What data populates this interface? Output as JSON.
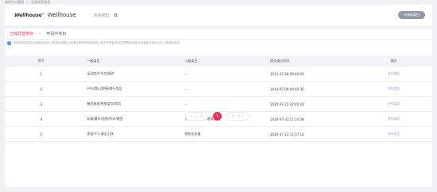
{
  "breadcrumb": {
    "parent": "商家中心管理",
    "current": "已有经营类目"
  },
  "shop": {
    "brand": "Wellhouse",
    "brand_mark": "®",
    "name": "Wellhouse",
    "type_label": "商家类型:",
    "type_value": "B",
    "apply_label": "申请新类目"
  },
  "tabs": [
    {
      "label": "已有经营类目",
      "active": true
    },
    {
      "label": "申请中类目",
      "active": false
    }
  ],
  "tab_separator": ">",
  "notice": "您的类目权限对应销售的商品上架类目范围,已经通过审核的类目商品上架将不受影响,若您需要申请新的经营类目请点击右上角按钮申请。",
  "table": {
    "headers": [
      "序号",
      "一级类目",
      "二级类目",
      "提交通过时间",
      "操作"
    ],
    "rows": [
      {
        "seq": "1",
        "cat1": "运动包/户外包/配件",
        "cat2": "--",
        "time": "2014-07-09 09:40:29",
        "action": "发布商品"
      },
      {
        "seq": "2",
        "cat1": "户外/登山/野营/旅行用品",
        "cat2": "--",
        "time": "2014-07-09 09:40:30",
        "action": "发布商品"
      },
      {
        "seq": "3",
        "cat1": "箱包皮具/热销女包/男包",
        "cat2": "--",
        "time": "2020-07-22 22:40:28",
        "action": "发布商品"
      },
      {
        "seq": "4",
        "cat1": "玩具/童车/益智/积木/模型",
        "cat2": "旅行口腔清洁护理用品",
        "time": "2020-07-23 11:24:38",
        "action": "发布商品"
      },
      {
        "seq": "5",
        "cat1": "家庭/个人清洁工具",
        "cat2": "隐形化妆器",
        "time": "2020-07-23 11:57:10",
        "action": "发布商品"
      }
    ]
  },
  "pagination": {
    "prev": "< 上一页",
    "current": "1",
    "next": "下一页 >"
  },
  "colors": {
    "accent": "#e6345e",
    "button_gray": "#8f98a6",
    "info_blue": "#3b82f6"
  }
}
